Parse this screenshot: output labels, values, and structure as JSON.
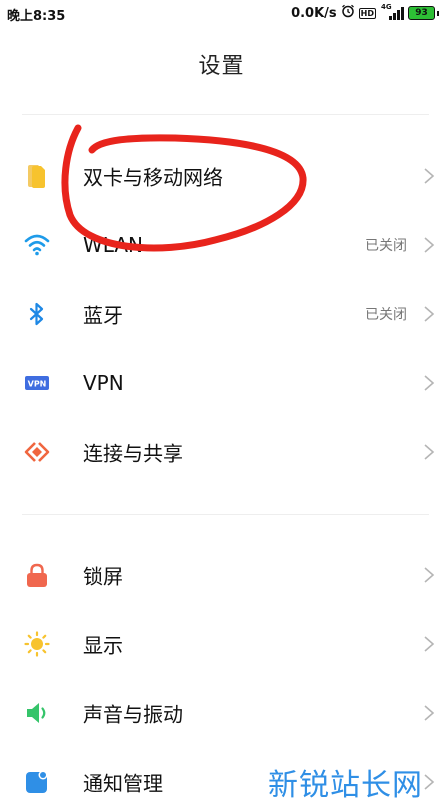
{
  "status_bar": {
    "time": "晚上8:35",
    "net_speed": "0.0K/s",
    "hd_badge": "HD",
    "network_type": "4G",
    "battery": "93",
    "icons": [
      "alarm-icon",
      "hd-icon",
      "signal-icon",
      "battery-icon"
    ]
  },
  "header": {
    "title": "设置"
  },
  "groups": [
    {
      "items": [
        {
          "label": "双卡与移动网络",
          "value": "",
          "icon": "sim-card-icon",
          "color": "#f7c32e"
        },
        {
          "label": "WLAN",
          "value": "已关闭",
          "icon": "wifi-icon",
          "color": "#1e9be9"
        },
        {
          "label": "蓝牙",
          "value": "已关闭",
          "icon": "bluetooth-icon",
          "color": "#1e88e5"
        },
        {
          "label": "VPN",
          "value": "",
          "icon": "vpn-icon",
          "color": "#3f6de0"
        },
        {
          "label": "连接与共享",
          "value": "",
          "icon": "share-icon",
          "color": "#f0663f"
        }
      ]
    },
    {
      "items": [
        {
          "label": "锁屏",
          "value": "",
          "icon": "lock-icon",
          "color": "#f0674e"
        },
        {
          "label": "显示",
          "value": "",
          "icon": "sun-icon",
          "color": "#f7c32e"
        },
        {
          "label": "声音与振动",
          "value": "",
          "icon": "speaker-icon",
          "color": "#35c46a"
        },
        {
          "label": "通知管理",
          "value": "",
          "icon": "notification-icon",
          "color": "#2f8fe6"
        }
      ]
    }
  ],
  "watermark": "新锐站长网",
  "colors": {
    "annotation": "#e8241c",
    "watermark": "#2f8fe6"
  }
}
